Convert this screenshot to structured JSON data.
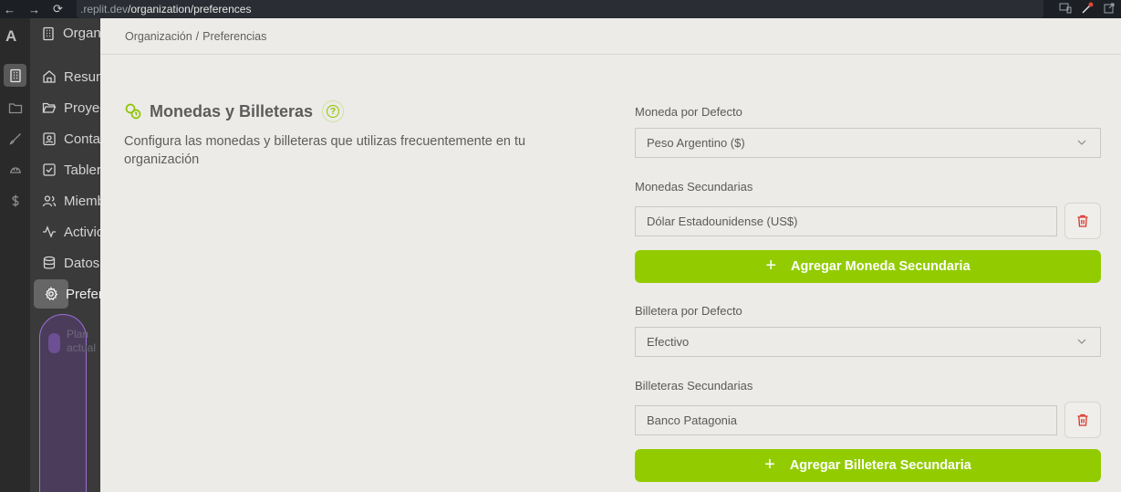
{
  "browser": {
    "url_prefix": ".replit.dev",
    "url_path": "/organization/preferences"
  },
  "rail": {
    "logo": "A",
    "icons": [
      "building-icon",
      "folder-icon",
      "brush-icon",
      "hardhat-icon",
      "dollar-icon"
    ]
  },
  "sidebar": {
    "org_label": "Organ",
    "items": [
      {
        "label": "Resum",
        "icon": "home-icon"
      },
      {
        "label": "Proyec",
        "icon": "folder-open-icon"
      },
      {
        "label": "Conta",
        "icon": "contact-icon"
      },
      {
        "label": "Tabler",
        "icon": "checkbox-icon"
      },
      {
        "label": "Miemb",
        "icon": "users-icon"
      },
      {
        "label": "Activic",
        "icon": "activity-icon"
      },
      {
        "label": "Datos",
        "icon": "database-icon"
      },
      {
        "label": "Prefer",
        "icon": "gear-icon"
      }
    ],
    "plan_line1": "Plan",
    "plan_line2": "actual"
  },
  "breadcrumb": {
    "parent": "Organización",
    "separator": "/",
    "current": "Preferencias"
  },
  "section": {
    "title": "Monedas y Billeteras",
    "help": "?",
    "description": "Configura las monedas y billeteras que utilizas frecuentemente en tu organización"
  },
  "form": {
    "default_currency_label": "Moneda por Defecto",
    "default_currency_value": "Peso Argentino ($)",
    "secondary_currencies_label": "Monedas Secundarias",
    "secondary_currencies": [
      "Dólar Estadounidense (US$)"
    ],
    "add_currency_button": "Agregar Moneda Secundaria",
    "default_wallet_label": "Billetera por Defecto",
    "default_wallet_value": "Efectivo",
    "secondary_wallets_label": "Billeteras Secundarias",
    "secondary_wallets": [
      "Banco Patagonia"
    ],
    "add_wallet_button": "Agregar Billetera Secundaria",
    "plus": "+"
  },
  "colors": {
    "accent": "#92cc00",
    "danger": "#d9342b"
  }
}
